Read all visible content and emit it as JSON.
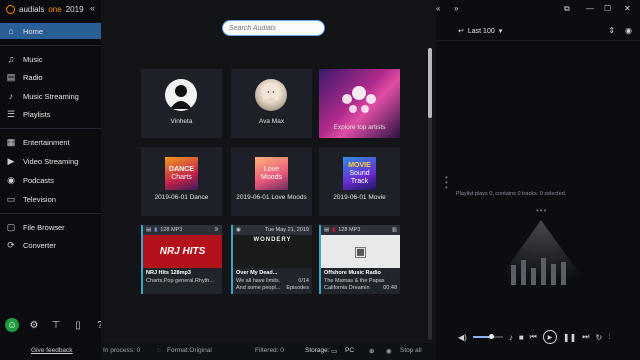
{
  "brand": {
    "name": "audials",
    "one": "one",
    "year": "2019"
  },
  "sidebar": {
    "items": [
      {
        "label": "Home",
        "icon": "home-icon"
      },
      {
        "label": "Music",
        "icon": "music-icon"
      },
      {
        "label": "Radio",
        "icon": "radio-icon"
      },
      {
        "label": "Music Streaming",
        "icon": "music-streaming-icon"
      },
      {
        "label": "Playlists",
        "icon": "playlists-icon"
      },
      {
        "label": "Entertainment",
        "icon": "entertainment-icon"
      },
      {
        "label": "Video Streaming",
        "icon": "video-streaming-icon"
      },
      {
        "label": "Podcasts",
        "icon": "podcasts-icon"
      },
      {
        "label": "Television",
        "icon": "television-icon"
      },
      {
        "label": "File Browser",
        "icon": "file-browser-icon"
      },
      {
        "label": "Converter",
        "icon": "converter-icon"
      }
    ],
    "feedback": "Give feedback"
  },
  "search": {
    "placeholder": "Search Audials"
  },
  "cards": [
    {
      "label": "Vinheta"
    },
    {
      "label": "Ava Max"
    },
    {
      "label": "Explore top artists"
    },
    {
      "label": "2019-06-01 Dance",
      "tile": [
        "DANCE",
        "Charts"
      ]
    },
    {
      "label": "2019-06-01 Love Moods",
      "tile": [
        "Love",
        "Moods"
      ]
    },
    {
      "label": "2019-06-01 Movie",
      "tile": [
        "MOVIE",
        "Sound",
        "Track"
      ]
    }
  ],
  "radios": [
    {
      "header": "128 MP3",
      "title": "NRJ Hits 128mp3",
      "line1": "Charts,Pop general,Rhyth...",
      "line2": "",
      "r1": "",
      "r2": "",
      "art_text": "NRJ HITS"
    },
    {
      "header": "Tue May 21, 2019",
      "title": "Over My Dead...",
      "line1": "We all have limits.",
      "line2": "And some peopl...",
      "r1": "0/14",
      "r2": "Episodes",
      "art_text": "WONDERY"
    },
    {
      "header": "128 MP3",
      "title": "Offshore Music Radio",
      "line1": "The Mamas & the Papas",
      "line2": "California Dreamin",
      "r1": "",
      "r2": "00:48",
      "art_text": ""
    }
  ],
  "right_panel": {
    "last100": "Last 100",
    "playlist_info": "Playlist plays 0, contains 0 tracks. 0 selected.",
    "dots": "•••"
  },
  "status": {
    "in_process": "In process: 0",
    "format": "Format:Original",
    "filtered": "Filtered: 0",
    "storage": "Storage:",
    "storage_val": "PC",
    "stop_all": "Stop all"
  },
  "colors": {
    "accent": "#2a5f96",
    "brand_orange": "#ff8a00",
    "search_border": "#5fa3e6"
  }
}
